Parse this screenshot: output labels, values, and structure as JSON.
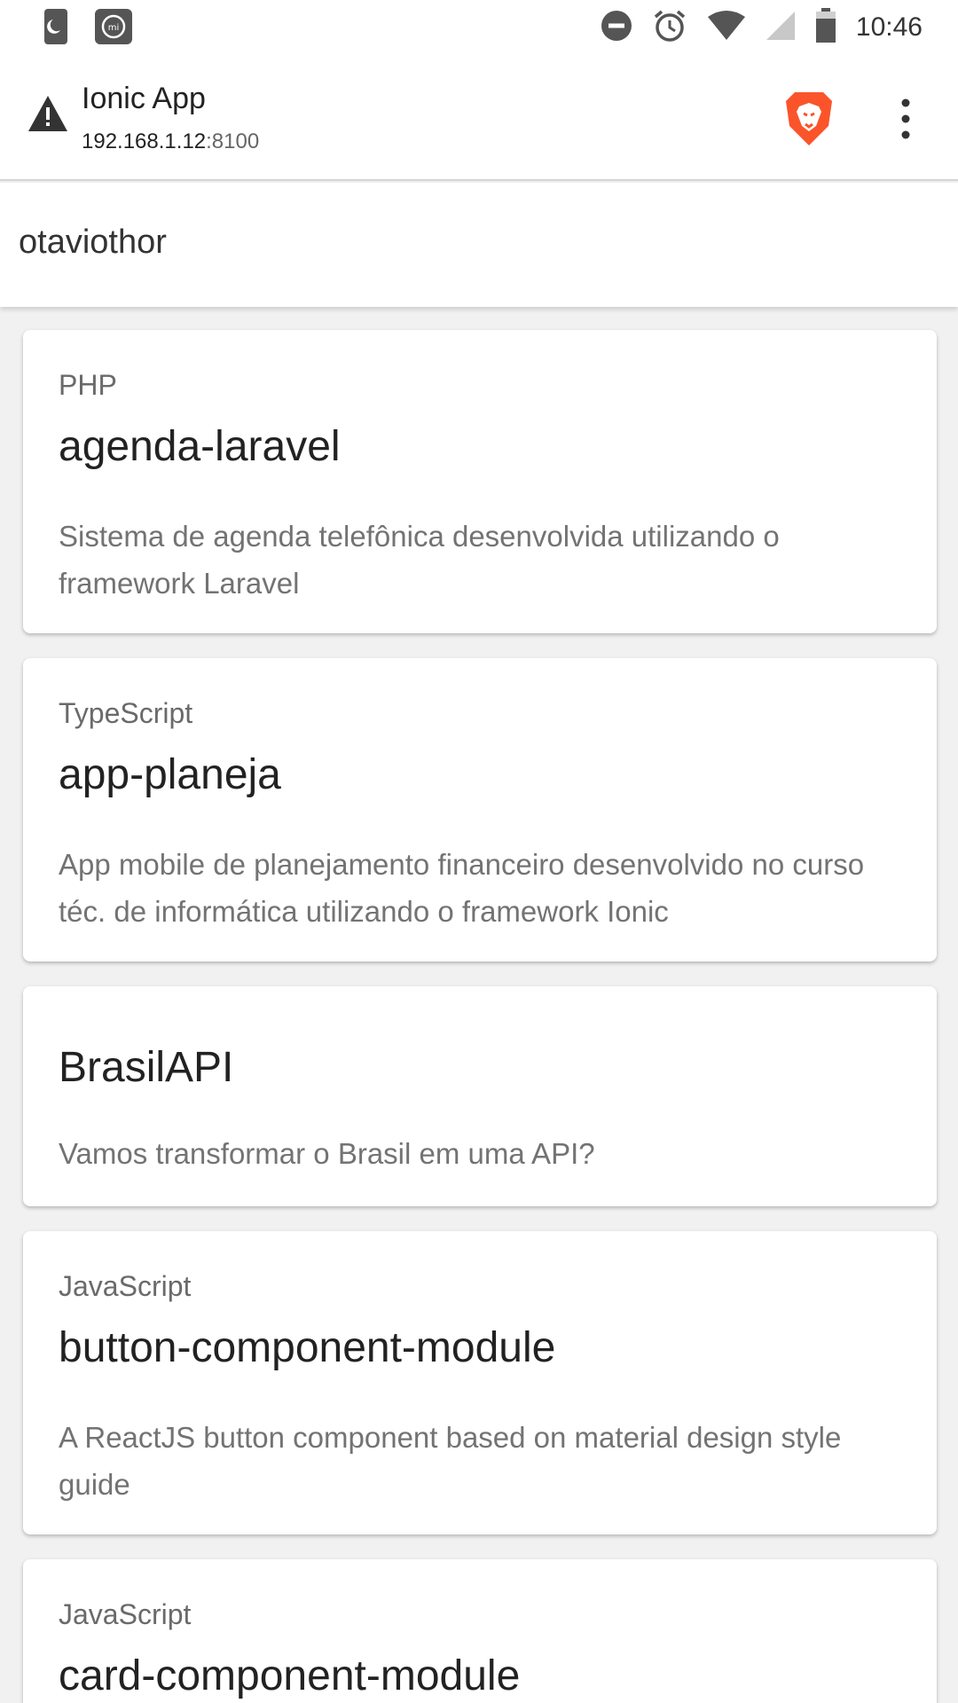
{
  "status_bar": {
    "time": "10:46",
    "left_icons": [
      "moon-app-icon",
      "mi-app-icon"
    ],
    "right_icons": [
      "do-not-disturb-icon",
      "alarm-icon",
      "wifi-icon",
      "signal-icon",
      "battery-icon"
    ]
  },
  "browser": {
    "page_title": "Ionic App",
    "url_host": "192.168.1.12",
    "url_port": ":8100",
    "icons": [
      "warning-icon",
      "brave-lion-icon",
      "more-vert-icon"
    ]
  },
  "toolbar": {
    "title": "otaviothor"
  },
  "repos": [
    {
      "language": "PHP",
      "name": "agenda-laravel",
      "description": "Sistema de agenda telefônica desenvolvida utilizando o framework Laravel"
    },
    {
      "language": "TypeScript",
      "name": "app-planeja",
      "description": "App mobile de planejamento financeiro desenvolvido no curso téc. de informática utilizando o framework Ionic"
    },
    {
      "language": "",
      "name": "BrasilAPI",
      "description": "Vamos transformar o Brasil em uma API?"
    },
    {
      "language": "JavaScript",
      "name": "button-component-module",
      "description": "A ReactJS button component based on material design style guide"
    },
    {
      "language": "JavaScript",
      "name": "card-component-module",
      "description": ""
    }
  ]
}
